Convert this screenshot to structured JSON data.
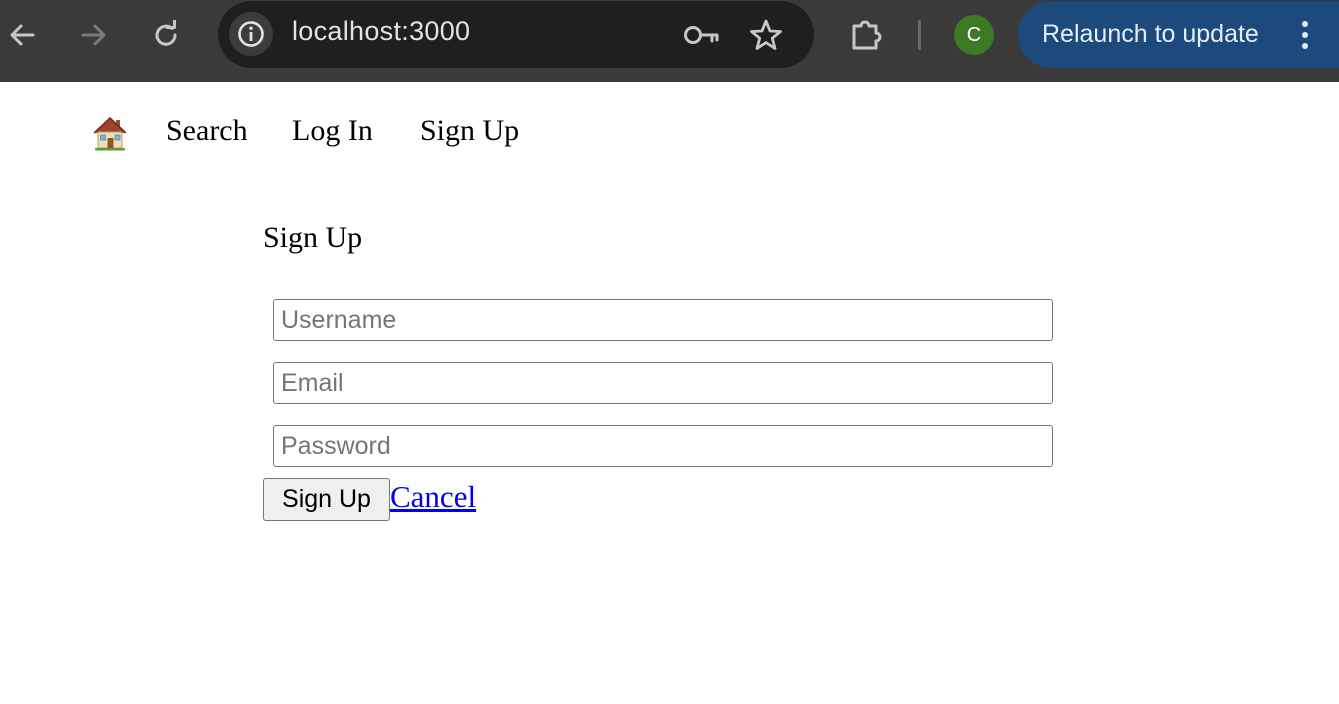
{
  "browser": {
    "url": "localhost:3000",
    "profile_initial": "C",
    "relaunch_label": "Relaunch to update",
    "icons": {
      "back": "arrow-left-icon",
      "forward": "arrow-right-icon",
      "reload": "reload-icon",
      "site_info": "info-icon",
      "password": "key-icon",
      "bookmark": "star-icon",
      "extensions": "puzzle-icon",
      "menu": "more-vert-icon"
    },
    "colors": {
      "toolbar": "#3a3a3a",
      "omnibox": "#1f1f1f",
      "relaunch": "#1d4a7c",
      "avatar": "#3d7a26"
    }
  },
  "nav": {
    "home_icon": "🏠",
    "search": "Search",
    "login": "Log In",
    "signup": "Sign Up"
  },
  "form": {
    "title": "Sign Up",
    "username_placeholder": "Username",
    "username_value": "",
    "email_placeholder": "Email",
    "email_value": "",
    "password_placeholder": "Password",
    "password_value": "",
    "submit_label": "Sign Up",
    "cancel_label": "Cancel",
    "link_color": "#0000ee"
  }
}
